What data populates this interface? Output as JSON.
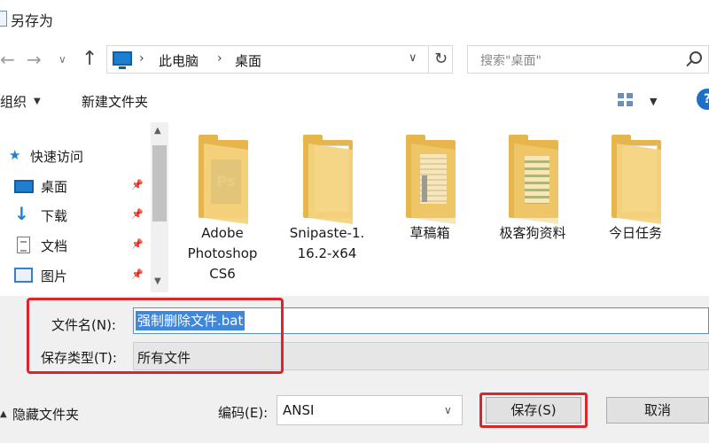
{
  "window": {
    "title": "另存为"
  },
  "nav": {
    "back": "←",
    "forward": "→",
    "recent": "∨",
    "up": "↑"
  },
  "address": {
    "separator": "›",
    "crumbs": [
      "此电脑",
      "桌面"
    ],
    "dropdown": "∨",
    "refresh": "↻"
  },
  "search": {
    "placeholder": "搜索\"桌面\""
  },
  "toolbar": {
    "organize": "组织",
    "new_folder": "新建文件夹",
    "help": "?"
  },
  "sidebar": {
    "items": [
      {
        "label": "快速访问",
        "icon": "star-icon"
      },
      {
        "label": "桌面",
        "icon": "desktop-icon",
        "pinned": true
      },
      {
        "label": "下载",
        "icon": "download-icon",
        "pinned": true
      },
      {
        "label": "文档",
        "icon": "document-icon",
        "pinned": true
      },
      {
        "label": "图片",
        "icon": "pictures-icon",
        "pinned": true
      }
    ]
  },
  "files": [
    {
      "name": "Adobe Photoshop CS6",
      "line1": "Adobe",
      "line2": "Photoshop",
      "line3": "CS6",
      "icon": "photoshop-folder-icon"
    },
    {
      "name": "Snipaste-1.16.2-x64",
      "line1": "Snipaste-1.",
      "line2": "16.2-x64",
      "icon": "folder-icon"
    },
    {
      "name": "草稿箱",
      "line1": "草稿箱",
      "icon": "folder-icon"
    },
    {
      "name": "极客狗资料",
      "line1": "极客狗资料",
      "icon": "spreadsheet-folder-icon"
    },
    {
      "name": "今日任务",
      "line1": "今日任务",
      "icon": "folder-icon"
    }
  ],
  "form": {
    "filename_label": "文件名(N):",
    "filename_value": "强制删除文件.bat",
    "type_label": "保存类型(T):",
    "type_value": "所有文件"
  },
  "footer": {
    "hide_folders": "隐藏文件夹",
    "encoding_label": "编码(E):",
    "encoding_value": "ANSI",
    "save": "保存(S)",
    "cancel": "取消"
  },
  "colors": {
    "accent": "#1e7fd0",
    "highlight": "#d9262d",
    "folder": "#e6b64c",
    "selection": "#3f86dd"
  }
}
